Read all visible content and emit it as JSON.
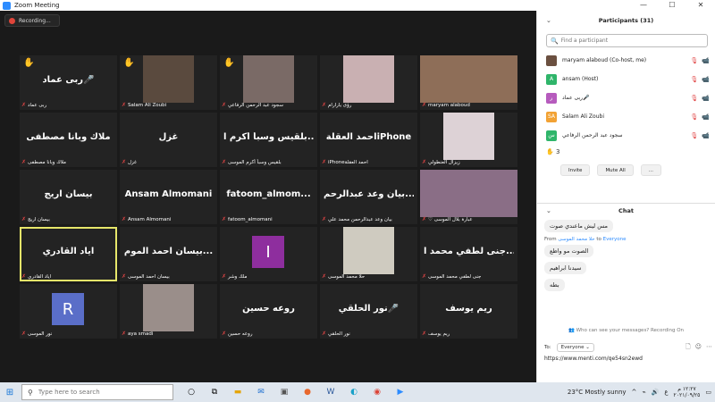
{
  "window": {
    "title": "Zoom Meeting",
    "min": "—",
    "max": "☐",
    "close": "✕"
  },
  "recording": {
    "label": "Recording..."
  },
  "tiles": [
    {
      "big": "ربى عماد🎤",
      "label": "ربى عماد",
      "hand": true,
      "type": "text"
    },
    {
      "big": "",
      "label": "Salam Ali Zoubi",
      "hand": true,
      "type": "photo",
      "color": "#5a4a3e"
    },
    {
      "big": "",
      "label": "سجود عبد الرحمن الرفاعي",
      "hand": true,
      "type": "photo",
      "color": "#7a6a66"
    },
    {
      "big": "",
      "label": "رؤى يارارام",
      "hand": false,
      "type": "photo",
      "color": "#c9b0b2"
    },
    {
      "big": "",
      "label": "maryam alaboud",
      "hand": false,
      "type": "photo-wide",
      "color": "#8e6e58"
    },
    {
      "big": "ملاك وبانا مصطفى",
      "label": "ملاك وبانا مصطفى",
      "hand": false,
      "type": "text"
    },
    {
      "big": "غزل",
      "label": "غزل",
      "hand": false,
      "type": "text"
    },
    {
      "big": "بلقيس وسبأ أكرم ا...",
      "label": "بلقيس وسبأ أكرم الموسى",
      "hand": false,
      "type": "text"
    },
    {
      "big": "احمد العقلةiPhone",
      "label": "iPhoneاحمد العقلة",
      "hand": false,
      "type": "text"
    },
    {
      "big": "",
      "label": "زيزال العنطولي",
      "hand": false,
      "type": "photo",
      "color": "#ddd2d6"
    },
    {
      "big": "بيسان اريج",
      "label": "بيسان اريج",
      "hand": false,
      "type": "text"
    },
    {
      "big": "Ansam Almomani",
      "label": "Ansam Almomani",
      "hand": false,
      "type": "text"
    },
    {
      "big": "fatoom_almom...",
      "label": "fatoom_almomani",
      "hand": false,
      "type": "text"
    },
    {
      "big": "بيان وعد عبدالرحم...",
      "label": "بيان وعد عبدالرحمن محمد علي",
      "hand": false,
      "type": "text"
    },
    {
      "big": "",
      "label": "♡ عبارة بلال الموسى",
      "hand": false,
      "type": "photo-wide",
      "color": "#8a6e86"
    },
    {
      "big": "اياد القادري",
      "label": "اياد القادري",
      "hand": false,
      "type": "text",
      "active": true
    },
    {
      "big": "بيسان احمد الموم...",
      "label": "بيسان احمد الموسى",
      "hand": false,
      "type": "text"
    },
    {
      "big": "",
      "label": "ملك وشر",
      "hand": false,
      "type": "avatar",
      "letter": "I",
      "color": "#8e2e9e"
    },
    {
      "big": "",
      "label": "حلا محمد الموسى",
      "hand": false,
      "type": "photo",
      "color": "#cfcbc0"
    },
    {
      "big": "جنى لطفي محمد ا...",
      "label": "جنى لطفي محمد الموسى",
      "hand": false,
      "type": "text"
    },
    {
      "big": "",
      "label": "نور الموسى",
      "hand": false,
      "type": "avatar",
      "letter": "R",
      "color": "#5a6ec8"
    },
    {
      "big": "",
      "label": "aya smadi",
      "hand": false,
      "type": "photo",
      "color": "#9a8e8a"
    },
    {
      "big": "روعه حسين",
      "label": "روعه حسين",
      "hand": false,
      "type": "text"
    },
    {
      "big": "نور الحلقي🎤",
      "label": "نور الحلقي",
      "hand": false,
      "type": "text"
    },
    {
      "big": "ريم يوسف",
      "label": "ريم يوسف",
      "hand": false,
      "type": "text"
    }
  ],
  "participants": {
    "title": "Participants (31)",
    "search_placeholder": "Find a participant",
    "list": [
      {
        "name": "maryam alaboud (Co-host, me)",
        "initial": "",
        "color": "#6b5040"
      },
      {
        "name": "ansam (Host)",
        "initial": "A",
        "color": "#2fb56a"
      },
      {
        "name": "ربى عماد🎤",
        "initial": "ر",
        "color": "#b65bbd"
      },
      {
        "name": "Salam Ali Zoubi",
        "initial": "SA",
        "color": "#f2a234"
      },
      {
        "name": "سجود عبد الرحمن الرفاعي",
        "initial": "س",
        "color": "#2fb56a"
      }
    ],
    "hand_count": "3",
    "invite": "Invite",
    "mute_all": "Mute All",
    "more": "..."
  },
  "chat": {
    "title": "Chat",
    "messages_top": [
      "مس ليش ماعندي صوت"
    ],
    "from_prefix": "From",
    "from_name": "حلا محمد الموسى",
    "from_to": "to",
    "from_target": "Everyone",
    "messages": [
      "الصوت مو واظع",
      "سيدنا ابراهيم",
      "بطه"
    ],
    "privacy": "Who can see your messages? Recording On",
    "to_label": "To:",
    "to_value": "Everyone",
    "input_value": "https://www.menti.com/qe54sn2ewd"
  },
  "taskbar": {
    "search_placeholder": "Type here to search",
    "weather": "23°C  Mostly sunny",
    "lang": "ع",
    "time": "١٢:٢٧ م",
    "date": "٢٠٢١/٠٩/٢٥"
  }
}
